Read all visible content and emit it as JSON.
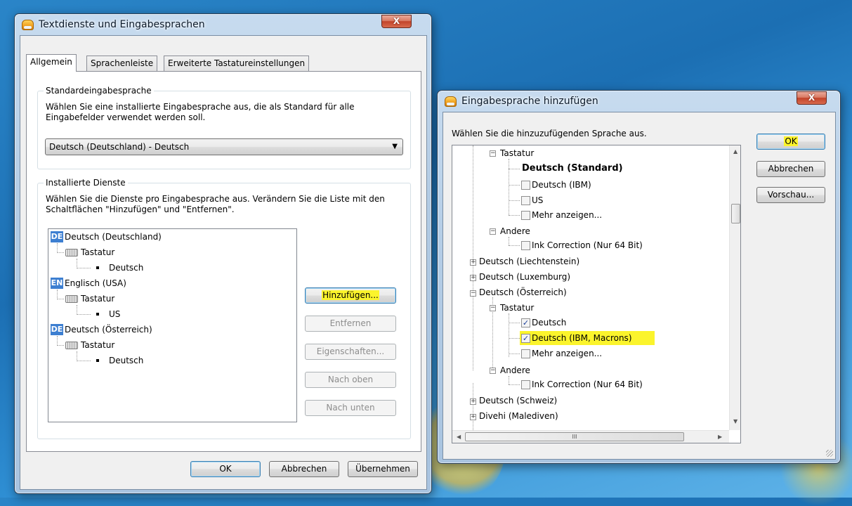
{
  "dialog_text_services": {
    "title": "Textdienste und Eingabesprachen",
    "close_label": "X",
    "tabs": [
      "Allgemein",
      "Sprachenleiste",
      "Erweiterte Tastatureinstellungen"
    ],
    "default_input": {
      "group_title": "Standardeingabesprache",
      "description": "Wählen Sie eine installierte Eingabesprache aus, die als Standard für alle Eingabefelder verwendet werden soll.",
      "selected_value": "Deutsch (Deutschland) - Deutsch"
    },
    "installed_services": {
      "group_title": "Installierte Dienste",
      "description": "Wählen Sie die Dienste pro Eingabesprache aus. Verändern Sie die Liste mit den Schaltflächen \"Hinzufügen\" und \"Entfernen\".",
      "tree": [
        {
          "badge": "DE",
          "language": "Deutsch (Deutschland)",
          "category": "Tastatur",
          "layout": "Deutsch"
        },
        {
          "badge": "EN",
          "language": "Englisch (USA)",
          "category": "Tastatur",
          "layout": "US"
        },
        {
          "badge": "DE",
          "language": "Deutsch (Österreich)",
          "category": "Tastatur",
          "layout": "Deutsch"
        }
      ],
      "buttons": {
        "add": "Hinzufügen...",
        "remove": "Entfernen",
        "properties": "Eigenschaften...",
        "move_up": "Nach oben",
        "move_down": "Nach unten"
      }
    },
    "footer": {
      "ok": "OK",
      "cancel": "Abbrechen",
      "apply": "Übernehmen"
    }
  },
  "dialog_add_language": {
    "title": "Eingabesprache hinzufügen",
    "close_label": "X",
    "prompt": "Wählen Sie die hinzuzufügenden Sprache aus.",
    "tree": {
      "tastatur_1": "Tastatur",
      "standard": "Deutsch (Standard)",
      "ibm": "Deutsch (IBM)",
      "us": "US",
      "more_1": "Mehr anzeigen...",
      "andere_1": "Andere",
      "ink_1": "Ink Correction (Nur 64 Bit)",
      "liechtenstein": "Deutsch (Liechtenstein)",
      "luxemburg": "Deutsch (Luxemburg)",
      "oesterreich": "Deutsch (Österreich)",
      "tastatur_2": "Tastatur",
      "deutsch_checked": "Deutsch",
      "ibm_macrons_checked": "Deutsch (IBM, Macrons)",
      "more_2": "Mehr anzeigen...",
      "andere_2": "Andere",
      "ink_2": "Ink Correction (Nur 64 Bit)",
      "schweiz": "Deutsch (Schweiz)",
      "divehi": "Divehi (Malediven)"
    },
    "checked": {
      "deutsch": true,
      "ibm_macrons": true
    },
    "buttons": {
      "ok": "OK",
      "cancel": "Abbrechen",
      "preview": "Vorschau..."
    },
    "scroll_glyph": "III"
  }
}
